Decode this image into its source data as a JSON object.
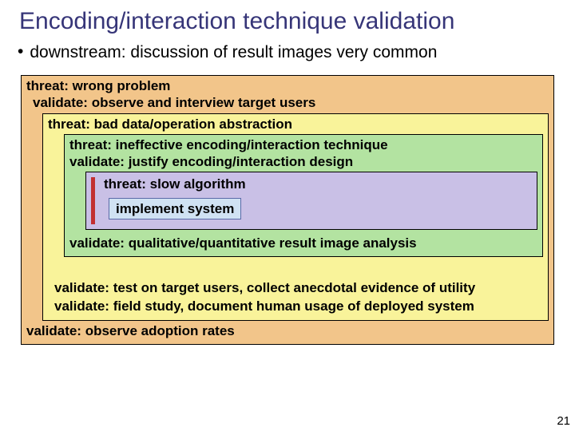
{
  "title": "Encoding/interaction technique validation",
  "bullet": "downstream: discussion of result images very common",
  "outer_threat": "threat: wrong problem",
  "outer_validate": "validate: observe and interview target users",
  "yellow_threat": "threat: bad data/operation abstraction",
  "green_threat": "threat: ineffective encoding/interaction technique",
  "green_validate": "validate: justify encoding/interaction design",
  "purple_threat": "threat: slow algorithm",
  "implement": "implement system",
  "green_validate2": "validate: qualitative/quantitative result image analysis",
  "yellow_validate1": "validate: test on target users, collect anecdotal evidence of utility",
  "yellow_validate2": "validate: field study, document human usage of deployed system",
  "outer_validate2": "validate: observe adoption rates",
  "slidenum": "21"
}
